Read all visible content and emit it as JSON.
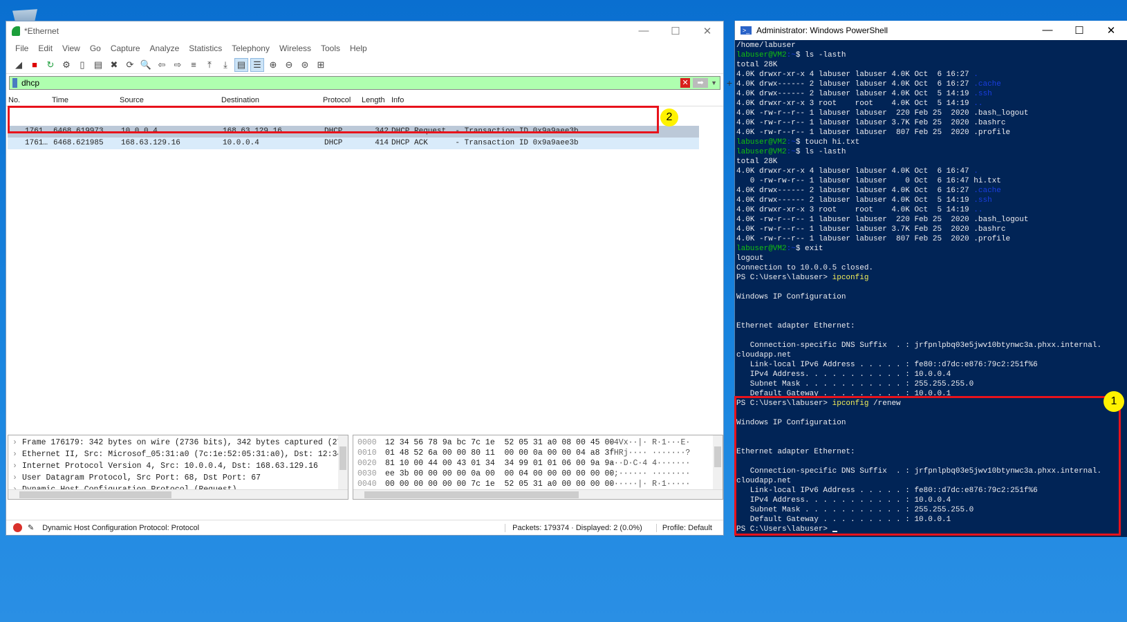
{
  "wireshark": {
    "title": "*Ethernet",
    "menu": [
      "File",
      "Edit",
      "View",
      "Go",
      "Capture",
      "Analyze",
      "Statistics",
      "Telephony",
      "Wireless",
      "Tools",
      "Help"
    ],
    "toolbar_icons": [
      "shark-fin-start-icon",
      "stop-icon",
      "restart-icon",
      "options-gear-icon",
      "open-file-icon",
      "save-file-icon",
      "close-file-icon",
      "reload-icon",
      "find-icon",
      "back-arrow-icon",
      "forward-arrow-icon",
      "go-to-packet-icon",
      "first-packet-icon",
      "last-packet-icon",
      "autoscroll-icon",
      "colorize-icon",
      "zoom-in-icon",
      "zoom-out-icon",
      "normal-size-icon",
      "resize-columns-icon"
    ],
    "filter": {
      "value": "dhcp"
    },
    "columns": [
      "No.",
      "Time",
      "Source",
      "Destination",
      "Protocol",
      "Length",
      "Info"
    ],
    "packets": [
      {
        "no": "1761…",
        "time": "6468.619973",
        "source": "10.0.0.4",
        "destination": "168.63.129.16",
        "protocol": "DHCP",
        "length": "342",
        "info": "DHCP Request  - Transaction ID 0x9a9aee3b"
      },
      {
        "no": "1761…",
        "time": "6468.621985",
        "source": "168.63.129.16",
        "destination": "10.0.0.4",
        "protocol": "DHCP",
        "length": "414",
        "info": "DHCP ACK      - Transaction ID 0x9a9aee3b"
      }
    ],
    "details": [
      "Frame 176179: 342 bytes on wire (2736 bits), 342 bytes captured (273",
      "Ethernet II, Src: Microsof_05:31:a0 (7c:1e:52:05:31:a0), Dst: 12:34:",
      "Internet Protocol Version 4, Src: 10.0.0.4, Dst: 168.63.129.16",
      "User Datagram Protocol, Src Port: 68, Dst Port: 67",
      "Dynamic Host Configuration Protocol (Request)"
    ],
    "hex": [
      {
        "offset": "0000",
        "bytes": "12 34 56 78 9a bc 7c 1e  52 05 31 a0 08 00 45 00",
        "ascii": "·4Vx··|· R·1···E·"
      },
      {
        "offset": "0010",
        "bytes": "01 48 52 6a 00 00 80 11  00 00 0a 00 00 04 a8 3f",
        "ascii": "·HRj···· ·······?"
      },
      {
        "offset": "0020",
        "bytes": "81 10 00 44 00 43 01 34  34 99 01 01 06 00 9a 9a",
        "ascii": "···D·C·4 4·······"
      },
      {
        "offset": "0030",
        "bytes": "ee 3b 00 00 00 00 0a 00  00 04 00 00 00 00 00 00",
        "ascii": "·;······ ········"
      },
      {
        "offset": "0040",
        "bytes": "00 00 00 00 00 00 7c 1e  52 05 31 a0 00 00 00 00",
        "ascii": "······|· R·1·····"
      }
    ],
    "status": {
      "field": "Dynamic Host Configuration Protocol: Protocol",
      "packets": "Packets: 179374 · Displayed: 2 (0.0%)",
      "profile": "Profile: Default"
    },
    "annotation": "2"
  },
  "powershell": {
    "title": "Administrator: Windows PowerShell",
    "annotation": "1",
    "colors": {
      "g": "#13c10e",
      "b": "#1a3ee0",
      "y": "#f2ee5a",
      "background": "#012456",
      "highlight": "#e8121b"
    },
    "lines": [
      [
        [
          "/home/labuser",
          "w"
        ]
      ],
      [
        [
          "labuser@VM2",
          "g"
        ],
        [
          ":~",
          "b"
        ],
        [
          "$ ls -lasth",
          "w"
        ]
      ],
      [
        [
          "total 28K",
          "w"
        ]
      ],
      [
        [
          "4.0K drwxr-xr-x 4 labuser labuser 4.0K Oct  6 16:27 ",
          "w"
        ],
        [
          ".",
          "b"
        ]
      ],
      [
        [
          "4.0K drwx------ 2 labuser labuser 4.0K Oct  6 16:27 ",
          "w"
        ],
        [
          ".cache",
          "b"
        ]
      ],
      [
        [
          "4.0K drwx------ 2 labuser labuser 4.0K Oct  5 14:19 ",
          "w"
        ],
        [
          ".ssh",
          "b"
        ]
      ],
      [
        [
          "4.0K drwxr-xr-x 3 root    root    4.0K Oct  5 14:19 ",
          "w"
        ],
        [
          "..",
          "b"
        ]
      ],
      [
        [
          "4.0K -rw-r--r-- 1 labuser labuser  220 Feb 25  2020 .bash_logout",
          "w"
        ]
      ],
      [
        [
          "4.0K -rw-r--r-- 1 labuser labuser 3.7K Feb 25  2020 .bashrc",
          "w"
        ]
      ],
      [
        [
          "4.0K -rw-r--r-- 1 labuser labuser  807 Feb 25  2020 .profile",
          "w"
        ]
      ],
      [
        [
          "labuser@VM2",
          "g"
        ],
        [
          ":~",
          "b"
        ],
        [
          "$ touch hi.txt",
          "w"
        ]
      ],
      [
        [
          "labuser@VM2",
          "g"
        ],
        [
          ":~",
          "b"
        ],
        [
          "$ ls -lasth",
          "w"
        ]
      ],
      [
        [
          "total 28K",
          "w"
        ]
      ],
      [
        [
          "4.0K drwxr-xr-x 4 labuser labuser 4.0K Oct  6 16:47 ",
          "w"
        ],
        [
          ".",
          "b"
        ]
      ],
      [
        [
          "   0 -rw-rw-r-- 1 labuser labuser    0 Oct  6 16:47 hi.txt",
          "w"
        ]
      ],
      [
        [
          "4.0K drwx------ 2 labuser labuser 4.0K Oct  6 16:27 ",
          "w"
        ],
        [
          ".cache",
          "b"
        ]
      ],
      [
        [
          "4.0K drwx------ 2 labuser labuser 4.0K Oct  5 14:19 ",
          "w"
        ],
        [
          ".ssh",
          "b"
        ]
      ],
      [
        [
          "4.0K drwxr-xr-x 3 root    root    4.0K Oct  5 14:19 ",
          "w"
        ],
        [
          "..",
          "b"
        ]
      ],
      [
        [
          "4.0K -rw-r--r-- 1 labuser labuser  220 Feb 25  2020 .bash_logout",
          "w"
        ]
      ],
      [
        [
          "4.0K -rw-r--r-- 1 labuser labuser 3.7K Feb 25  2020 .bashrc",
          "w"
        ]
      ],
      [
        [
          "4.0K -rw-r--r-- 1 labuser labuser  807 Feb 25  2020 .profile",
          "w"
        ]
      ],
      [
        [
          "labuser@VM2",
          "g"
        ],
        [
          ":~",
          "b"
        ],
        [
          "$ exit",
          "w"
        ]
      ],
      [
        [
          "logout",
          "w"
        ]
      ],
      [
        [
          "Connection to 10.0.0.5 closed.",
          "w"
        ]
      ],
      [
        [
          "PS C:\\Users\\labuser> ",
          "w"
        ],
        [
          "ipconfig",
          "y"
        ]
      ],
      [],
      [
        [
          "Windows IP Configuration",
          "w"
        ]
      ],
      [],
      [],
      [
        [
          "Ethernet adapter Ethernet:",
          "w"
        ]
      ],
      [],
      [
        [
          "   Connection-specific DNS Suffix  . : jrfpnlpbq03e5jwv10btynwc3a.phxx.internal.",
          "w"
        ]
      ],
      [
        [
          "cloudapp.net",
          "w"
        ]
      ],
      [
        [
          "   Link-local IPv6 Address . . . . . : fe80::d7dc:e876:79c2:251f%6",
          "w"
        ]
      ],
      [
        [
          "   IPv4 Address. . . . . . . . . . . : 10.0.0.4",
          "w"
        ]
      ],
      [
        [
          "   Subnet Mask . . . . . . . . . . . : 255.255.255.0",
          "w"
        ]
      ],
      [
        [
          "   Default Gateway . . . . . . . . . : 10.0.0.1",
          "w"
        ]
      ],
      [
        [
          "PS C:\\Users\\labuser> ",
          "w"
        ],
        [
          "ipconfig",
          "y"
        ],
        [
          " /renew",
          "w"
        ]
      ],
      [],
      [
        [
          "Windows IP Configuration",
          "w"
        ]
      ],
      [],
      [],
      [
        [
          "Ethernet adapter Ethernet:",
          "w"
        ]
      ],
      [],
      [
        [
          "   Connection-specific DNS Suffix  . : jrfpnlpbq03e5jwv10btynwc3a.phxx.internal.",
          "w"
        ]
      ],
      [
        [
          "cloudapp.net",
          "w"
        ]
      ],
      [
        [
          "   Link-local IPv6 Address . . . . . : fe80::d7dc:e876:79c2:251f%6",
          "w"
        ]
      ],
      [
        [
          "   IPv4 Address. . . . . . . . . . . : 10.0.0.4",
          "w"
        ]
      ],
      [
        [
          "   Subnet Mask . . . . . . . . . . . : 255.255.255.0",
          "w"
        ]
      ],
      [
        [
          "   Default Gateway . . . . . . . . . : 10.0.0.1",
          "w"
        ]
      ],
      [
        [
          "PS C:\\Users\\labuser> ",
          "w"
        ]
      ]
    ]
  }
}
